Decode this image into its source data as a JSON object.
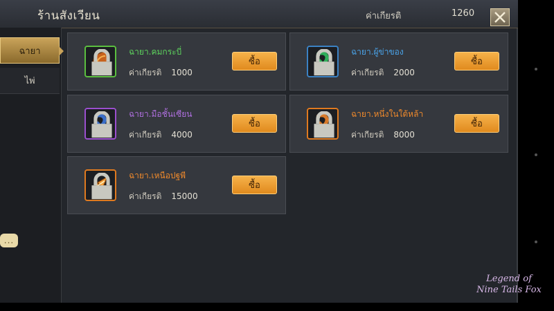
{
  "header": {
    "title": "ร้านสังเวียน",
    "honor_label": "ค่าเกียรติ",
    "honor_value": "1260"
  },
  "sidebar": {
    "tabs": [
      {
        "label": "ฉายา",
        "active": true
      },
      {
        "label": "ไพ่",
        "active": false
      }
    ]
  },
  "items": [
    {
      "name": "ฉายา.คมกระบี่",
      "name_color": "#5dd35d",
      "honor_label": "ค่าเกียรติ",
      "cost": "1000",
      "buy_label": "ซื้อ",
      "frame_color": "#5bbf3f",
      "icon": "green-fang-icon"
    },
    {
      "name": "ฉายา.ผู้ข่าของ",
      "name_color": "#4aa3e8",
      "honor_label": "ค่าเกียรติ",
      "cost": "2000",
      "buy_label": "ซื้อ",
      "frame_color": "#3b82c4",
      "icon": "blue-serpent-icon"
    },
    {
      "name": "ฉายา.มือชั้นเซียน",
      "name_color": "#b070e0",
      "honor_label": "ค่าเกียรติ",
      "cost": "4000",
      "buy_label": "ซื้อ",
      "frame_color": "#9b4fcf",
      "icon": "purple-serpent-icon"
    },
    {
      "name": "ฉายา.หนึ่งในใต้หล้า",
      "name_color": "#f08a2c",
      "honor_label": "ค่าเกียรติ",
      "cost": "8000",
      "buy_label": "ซื้อ",
      "frame_color": "#e07a1f",
      "icon": "orange-serpent-icon"
    },
    {
      "name": "ฉายา.เหนือปฐพี",
      "name_color": "#f08a2c",
      "honor_label": "ค่าเกียรติ",
      "cost": "15000",
      "buy_label": "ซื้อ",
      "frame_color": "#e07a1f",
      "icon": "flame-horn-icon"
    }
  ],
  "chat_button": "...",
  "watermark": {
    "line1": "Legend of",
    "line2": "Nine Tails Fox"
  }
}
